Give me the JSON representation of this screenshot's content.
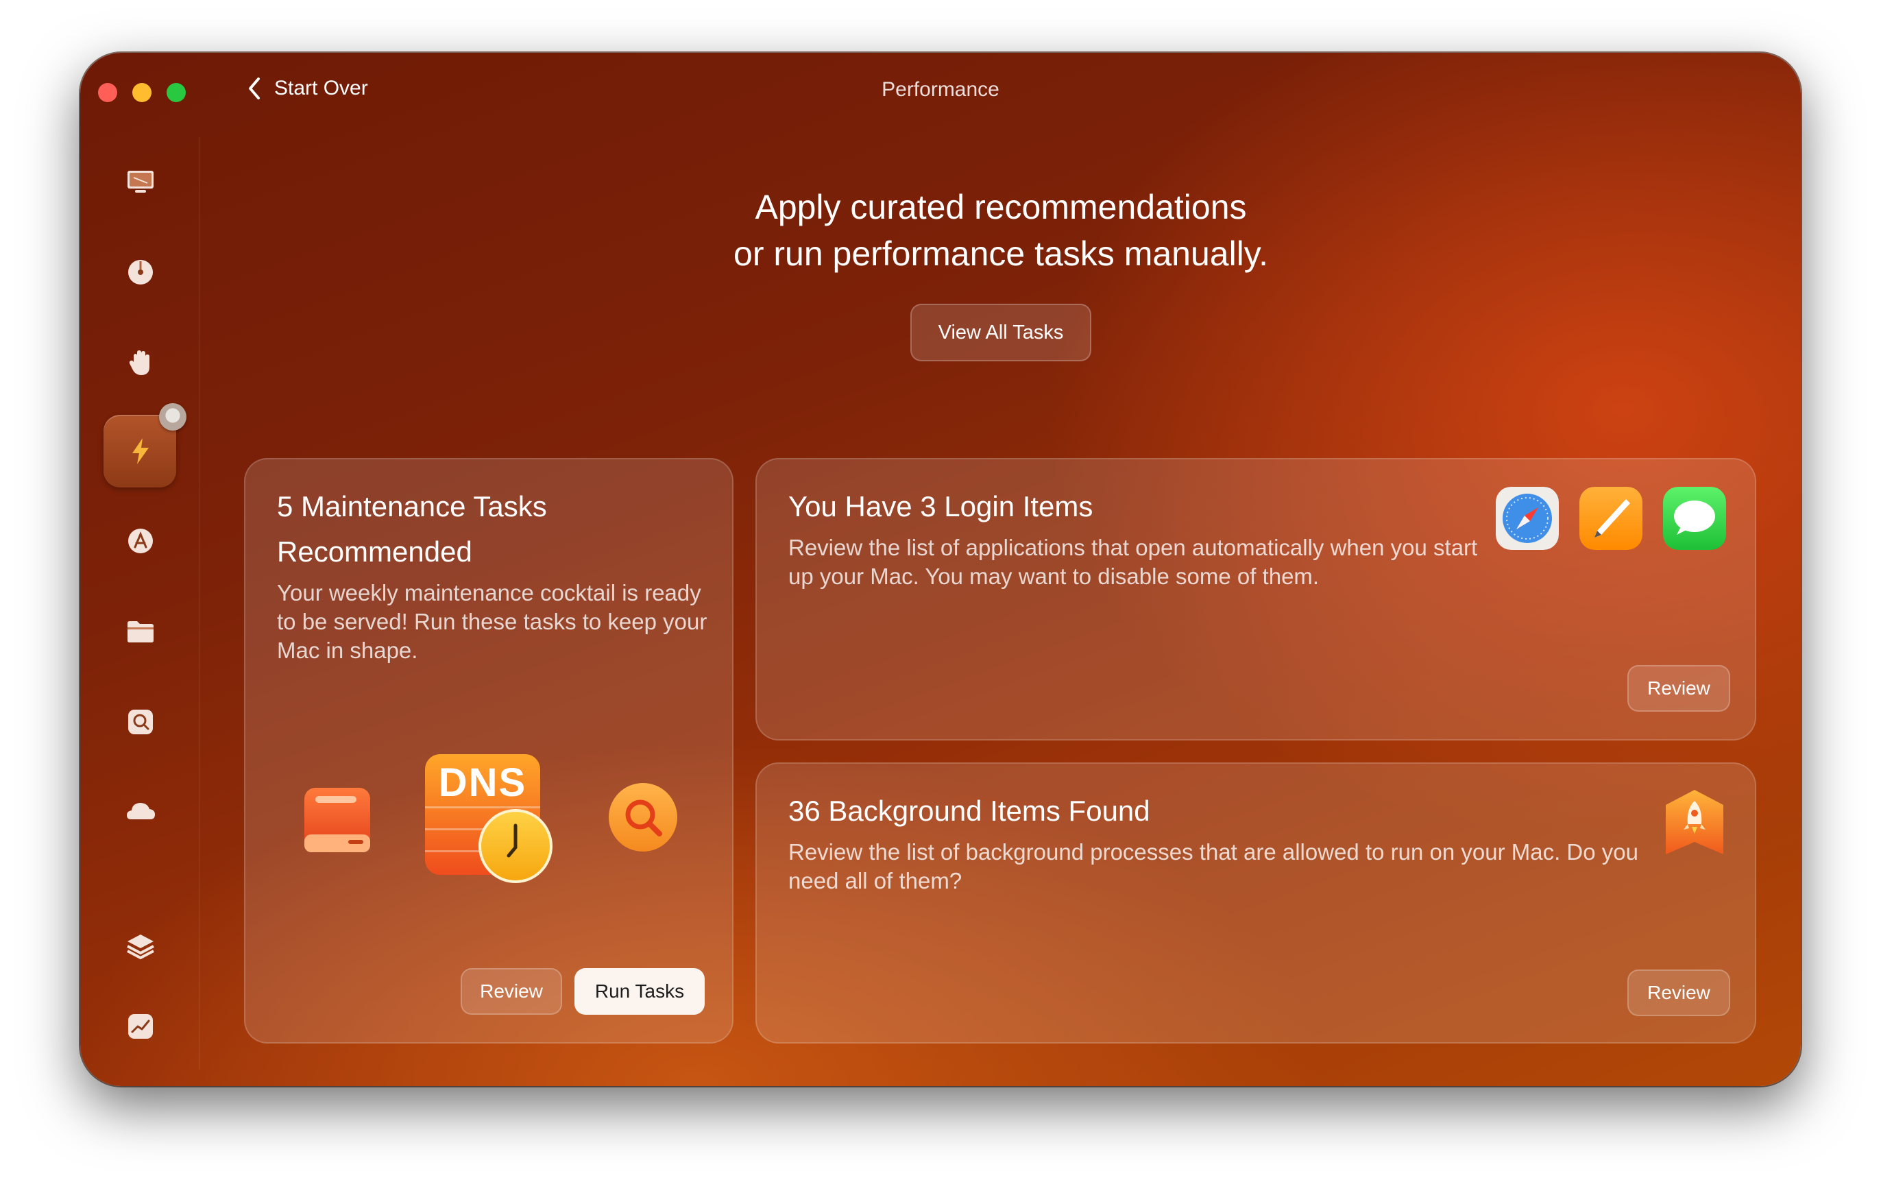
{
  "window": {
    "title": "Performance"
  },
  "nav": {
    "back_label": "Start Over"
  },
  "sidebar": {
    "items": [
      {
        "name": "smart-care",
        "icon": "display-icon"
      },
      {
        "name": "cleanup",
        "icon": "disk-icon"
      },
      {
        "name": "protection",
        "icon": "hand-icon"
      },
      {
        "name": "performance",
        "icon": "lightning-icon",
        "active": true
      },
      {
        "name": "applications",
        "icon": "app-icon"
      },
      {
        "name": "files",
        "icon": "folder-icon"
      },
      {
        "name": "space-lens",
        "icon": "lens-icon"
      },
      {
        "name": "cloud",
        "icon": "cloud-icon"
      },
      {
        "name": "storage",
        "icon": "layers-icon"
      },
      {
        "name": "monitor",
        "icon": "chart-icon"
      }
    ]
  },
  "main": {
    "headline_line1": "Apply curated recommendations",
    "headline_line2": "or run performance tasks manually.",
    "view_all_label": "View All Tasks"
  },
  "cards": {
    "maintenance": {
      "title_line1": "5 Maintenance Tasks",
      "title_line2": "Recommended",
      "description": "Your weekly maintenance cocktail is ready to be served! Run these tasks to keep your Mac in shape.",
      "dns_label": "DNS",
      "review_label": "Review",
      "run_label": "Run Tasks"
    },
    "login": {
      "title": "You Have 3 Login Items",
      "description": "Review the list of applications that open automatically when you start up your Mac. You may want to disable some of them.",
      "review_label": "Review",
      "icons": [
        "safari-icon",
        "pages-icon",
        "messages-icon"
      ]
    },
    "background": {
      "title": "36 Background Items Found",
      "description": "Review the list of background processes that are allowed to run on your Mac. Do you need all of them?",
      "review_label": "Review",
      "icon": "rocket-badge-icon"
    }
  }
}
